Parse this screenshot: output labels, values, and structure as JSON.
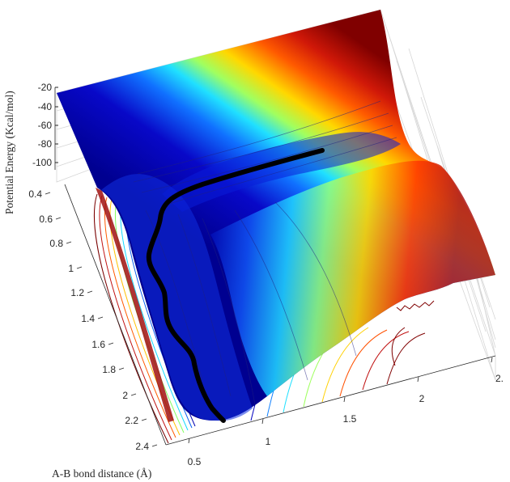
{
  "chart_data": {
    "type": "surface",
    "title": "",
    "zlabel": "Potential Energy (Kcal/mol)",
    "xlabel": "A-B bond distance (Å)",
    "ylabel": "",
    "z_ticks": [
      "-20",
      "-40",
      "-60",
      "-80",
      "-100"
    ],
    "y_ticks": [
      "0.4",
      "0.6",
      "0.8",
      "1",
      "1.2",
      "1.4",
      "1.6",
      "1.8",
      "2",
      "2.2",
      "2.4"
    ],
    "x_ticks": [
      "0.5",
      "1",
      "1.5",
      "2",
      "2."
    ],
    "zlim": [
      -110,
      -20
    ],
    "colormap": "jet",
    "grid": true,
    "trajectory_color": "#000000"
  }
}
